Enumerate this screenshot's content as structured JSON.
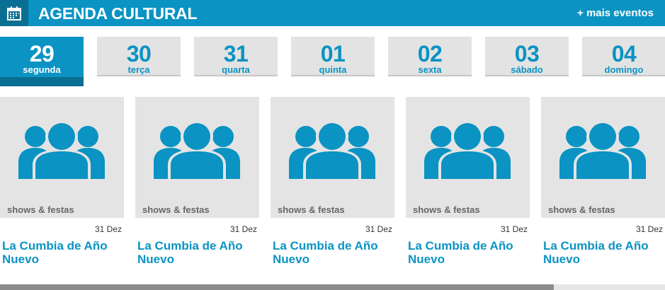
{
  "header": {
    "title": "AGENDA CULTURAL",
    "more_link": "+ mais eventos",
    "calendar_icon": "calendar-icon"
  },
  "days": [
    {
      "num": "29",
      "weekday": "segunda",
      "active": true
    },
    {
      "num": "30",
      "weekday": "terça",
      "active": false
    },
    {
      "num": "31",
      "weekday": "quarta",
      "active": false
    },
    {
      "num": "01",
      "weekday": "quinta",
      "active": false
    },
    {
      "num": "02",
      "weekday": "sexta",
      "active": false
    },
    {
      "num": "03",
      "weekday": "sábado",
      "active": false
    },
    {
      "num": "04",
      "weekday": "domingo",
      "active": false
    }
  ],
  "events": [
    {
      "category": "shows & festas",
      "date": "31 Dez",
      "title": "La Cumbia de Año Nuevo",
      "icon": "group-icon"
    },
    {
      "category": "shows & festas",
      "date": "31 Dez",
      "title": "La Cumbia de Año Nuevo",
      "icon": "group-icon"
    },
    {
      "category": "shows & festas",
      "date": "31 Dez",
      "title": "La Cumbia de Año Nuevo",
      "icon": "group-icon"
    },
    {
      "category": "shows & festas",
      "date": "31 Dez",
      "title": "La Cumbia de Año Nuevo",
      "icon": "group-icon"
    },
    {
      "category": "shows & festas",
      "date": "31 Dez",
      "title": "La Cumbia de Año Nuevo",
      "icon": "group-icon"
    }
  ],
  "scroll": {
    "position_fraction": 0.0,
    "visible_fraction": 0.833
  },
  "colors": {
    "accent": "#0a93c3",
    "accent_dark": "#0a6f93",
    "tile_bg": "#e3e3e3"
  }
}
